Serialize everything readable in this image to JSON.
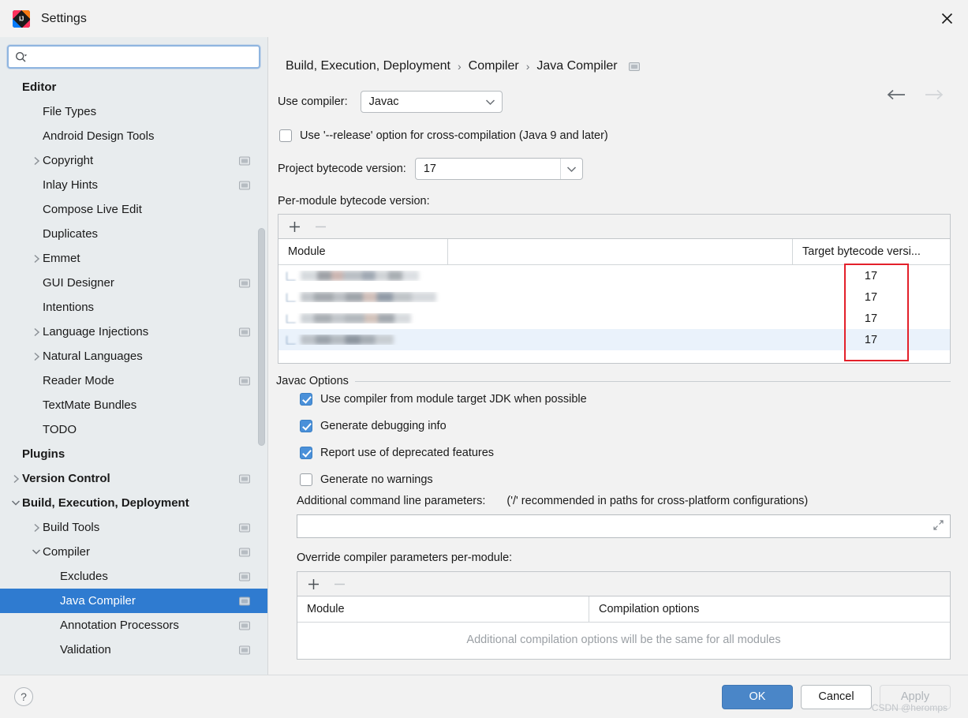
{
  "window": {
    "title": "Settings",
    "logo_icon": "intellij-idea-logo",
    "close_icon": "close-icon"
  },
  "search": {
    "icon": "search-icon",
    "value": "",
    "placeholder": ""
  },
  "sidebar": {
    "items": [
      {
        "label": "Editor",
        "level": 0,
        "bold": true,
        "chevron": "",
        "badge": false
      },
      {
        "label": "File Types",
        "level": 1,
        "bold": false,
        "chevron": "",
        "badge": false
      },
      {
        "label": "Android Design Tools",
        "level": 1,
        "bold": false,
        "chevron": "",
        "badge": false
      },
      {
        "label": "Copyright",
        "level": 1,
        "bold": false,
        "chevron": "right",
        "badge": true
      },
      {
        "label": "Inlay Hints",
        "level": 1,
        "bold": false,
        "chevron": "",
        "badge": true
      },
      {
        "label": "Compose Live Edit",
        "level": 1,
        "bold": false,
        "chevron": "",
        "badge": false
      },
      {
        "label": "Duplicates",
        "level": 1,
        "bold": false,
        "chevron": "",
        "badge": false
      },
      {
        "label": "Emmet",
        "level": 1,
        "bold": false,
        "chevron": "right",
        "badge": false
      },
      {
        "label": "GUI Designer",
        "level": 1,
        "bold": false,
        "chevron": "",
        "badge": true
      },
      {
        "label": "Intentions",
        "level": 1,
        "bold": false,
        "chevron": "",
        "badge": false
      },
      {
        "label": "Language Injections",
        "level": 1,
        "bold": false,
        "chevron": "right",
        "badge": true
      },
      {
        "label": "Natural Languages",
        "level": 1,
        "bold": false,
        "chevron": "right",
        "badge": false
      },
      {
        "label": "Reader Mode",
        "level": 1,
        "bold": false,
        "chevron": "",
        "badge": true
      },
      {
        "label": "TextMate Bundles",
        "level": 1,
        "bold": false,
        "chevron": "",
        "badge": false
      },
      {
        "label": "TODO",
        "level": 1,
        "bold": false,
        "chevron": "",
        "badge": false
      },
      {
        "label": "Plugins",
        "level": 0,
        "bold": true,
        "chevron": "",
        "badge": false
      },
      {
        "label": "Version Control",
        "level": 0,
        "bold": true,
        "chevron": "right",
        "badge": true
      },
      {
        "label": "Build, Execution, Deployment",
        "level": 0,
        "bold": true,
        "chevron": "down",
        "badge": false
      },
      {
        "label": "Build Tools",
        "level": 1,
        "bold": false,
        "chevron": "right",
        "badge": true
      },
      {
        "label": "Compiler",
        "level": 1,
        "bold": false,
        "chevron": "down",
        "badge": true
      },
      {
        "label": "Excludes",
        "level": 2,
        "bold": false,
        "chevron": "",
        "badge": true
      },
      {
        "label": "Java Compiler",
        "level": 2,
        "bold": false,
        "chevron": "",
        "badge": true,
        "selected": true
      },
      {
        "label": "Annotation Processors",
        "level": 2,
        "bold": false,
        "chevron": "",
        "badge": true
      },
      {
        "label": "Validation",
        "level": 2,
        "bold": false,
        "chevron": "",
        "badge": true
      }
    ]
  },
  "breadcrumb": {
    "parts": [
      "Build, Execution, Deployment",
      "Compiler",
      "Java Compiler"
    ],
    "separator": "›",
    "badge_icon": "project-scope-badge-icon"
  },
  "nav": {
    "back_icon": "arrow-left-icon",
    "forward_icon": "arrow-right-icon"
  },
  "form": {
    "use_compiler_label": "Use compiler:",
    "use_compiler_value": "Javac",
    "release_option_label": "Use '--release' option for cross-compilation (Java 9 and later)",
    "release_option_checked": false,
    "project_bytecode_label": "Project bytecode version:",
    "project_bytecode_value": "17"
  },
  "per_module_table": {
    "title": "Per-module bytecode version:",
    "add_icon": "plus-icon",
    "remove_icon": "minus-icon",
    "columns": [
      "Module",
      "",
      "Target bytecode versi..."
    ],
    "rows": [
      {
        "module": "",
        "censored": true,
        "target": "17",
        "selected": false
      },
      {
        "module": "",
        "censored": true,
        "target": "17",
        "selected": false
      },
      {
        "module": "",
        "censored": true,
        "target": "17",
        "selected": false
      },
      {
        "module": "",
        "censored": true,
        "target": "17",
        "selected": true
      }
    ],
    "highlight_color": "#e3202a"
  },
  "javac_options": {
    "section_title": "Javac Options",
    "checkboxes": [
      {
        "label": "Use compiler from module target JDK when possible",
        "checked": true
      },
      {
        "label": "Generate debugging info",
        "checked": true
      },
      {
        "label": "Report use of deprecated features",
        "checked": true
      },
      {
        "label": "Generate no warnings",
        "checked": false
      }
    ],
    "additional_params_label": "Additional command line parameters:",
    "additional_params_hint": "('/' recommended in paths for cross-platform configurations)",
    "additional_params_value": "",
    "expand_icon": "expand-icon"
  },
  "override_table": {
    "title": "Override compiler parameters per-module:",
    "add_icon": "plus-icon",
    "remove_icon": "minus-icon",
    "columns": [
      "Module",
      "Compilation options"
    ],
    "empty_text": "Additional compilation options will be the same for all modules"
  },
  "footer": {
    "help_label": "?",
    "ok_label": "OK",
    "cancel_label": "Cancel",
    "apply_label": "Apply",
    "apply_enabled": false,
    "watermark": "CSDN @heromps"
  },
  "colors": {
    "accent": "#2f7bd0",
    "primary_button": "#4a86c8",
    "checkbox_on": "#4a90d9",
    "highlight": "#e3202a",
    "sidebar_bg": "#e8ecee"
  }
}
